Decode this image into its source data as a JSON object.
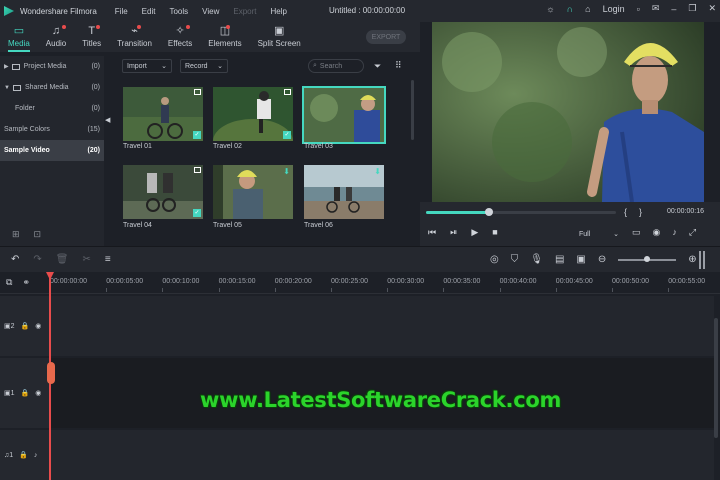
{
  "app": {
    "name": "Wondershare Filmora",
    "document_title": "Untitled : 00:00:00:00"
  },
  "menu": [
    "File",
    "Edit",
    "Tools",
    "View",
    "Export",
    "Help"
  ],
  "menu_disabled": [
    "Export"
  ],
  "titlebar_right": {
    "login": "Login"
  },
  "tabs": [
    {
      "label": "Media",
      "icon": "folder-icon",
      "active": true
    },
    {
      "label": "Audio",
      "icon": "music-note-icon",
      "badge": true
    },
    {
      "label": "Titles",
      "icon": "text-icon",
      "badge": true
    },
    {
      "label": "Transition",
      "icon": "transition-icon",
      "badge": true
    },
    {
      "label": "Effects",
      "icon": "effects-icon",
      "badge": true
    },
    {
      "label": "Elements",
      "icon": "elements-icon",
      "badge": true
    },
    {
      "label": "Split Screen",
      "icon": "split-screen-icon"
    }
  ],
  "export_button": "EXPORT",
  "sidebar": {
    "items": [
      {
        "label": "Project Media",
        "count": "(0)",
        "caret": "▶"
      },
      {
        "label": "Shared Media",
        "count": "(0)",
        "caret": "▼"
      },
      {
        "label": "Folder",
        "count": "(0)"
      },
      {
        "label": "Sample Colors",
        "count": "(15)"
      },
      {
        "label": "Sample Video",
        "count": "(20)",
        "active": true
      }
    ]
  },
  "library": {
    "import_label": "Import",
    "record_label": "Record",
    "search_placeholder": "Search",
    "clips": [
      {
        "label": "Travel 01",
        "added": true
      },
      {
        "label": "Travel 02",
        "added": true
      },
      {
        "label": "Travel 03",
        "selected": true
      },
      {
        "label": "Travel 04",
        "added": true
      },
      {
        "label": "Travel 05",
        "download": true
      },
      {
        "label": "Travel 06",
        "download": true
      }
    ]
  },
  "player": {
    "progress": 0.33,
    "timecode": "00:00:00:16",
    "quality": "Full",
    "bracket_in": "{",
    "bracket_out": "}"
  },
  "timeline": {
    "zoom": 0.5,
    "ruler": [
      "00:00:00:00",
      "00:00:05:00",
      "00:00:10:00",
      "00:00:15:00",
      "00:00:20:00",
      "00:00:25:00",
      "00:00:30:00",
      "00:00:35:00",
      "00:00:40:00",
      "00:00:45:00",
      "00:00:50:00",
      "00:00:55:00"
    ],
    "tracks": [
      {
        "label": "2",
        "type": "video"
      },
      {
        "label": "1",
        "type": "video"
      },
      {
        "label": "1",
        "type": "audio"
      }
    ]
  },
  "watermark": "www.LatestSoftwareCrack.com",
  "colors": {
    "accent": "#45d8c0",
    "playhead": "#e84c4c",
    "watermark": "#2bd42b"
  }
}
